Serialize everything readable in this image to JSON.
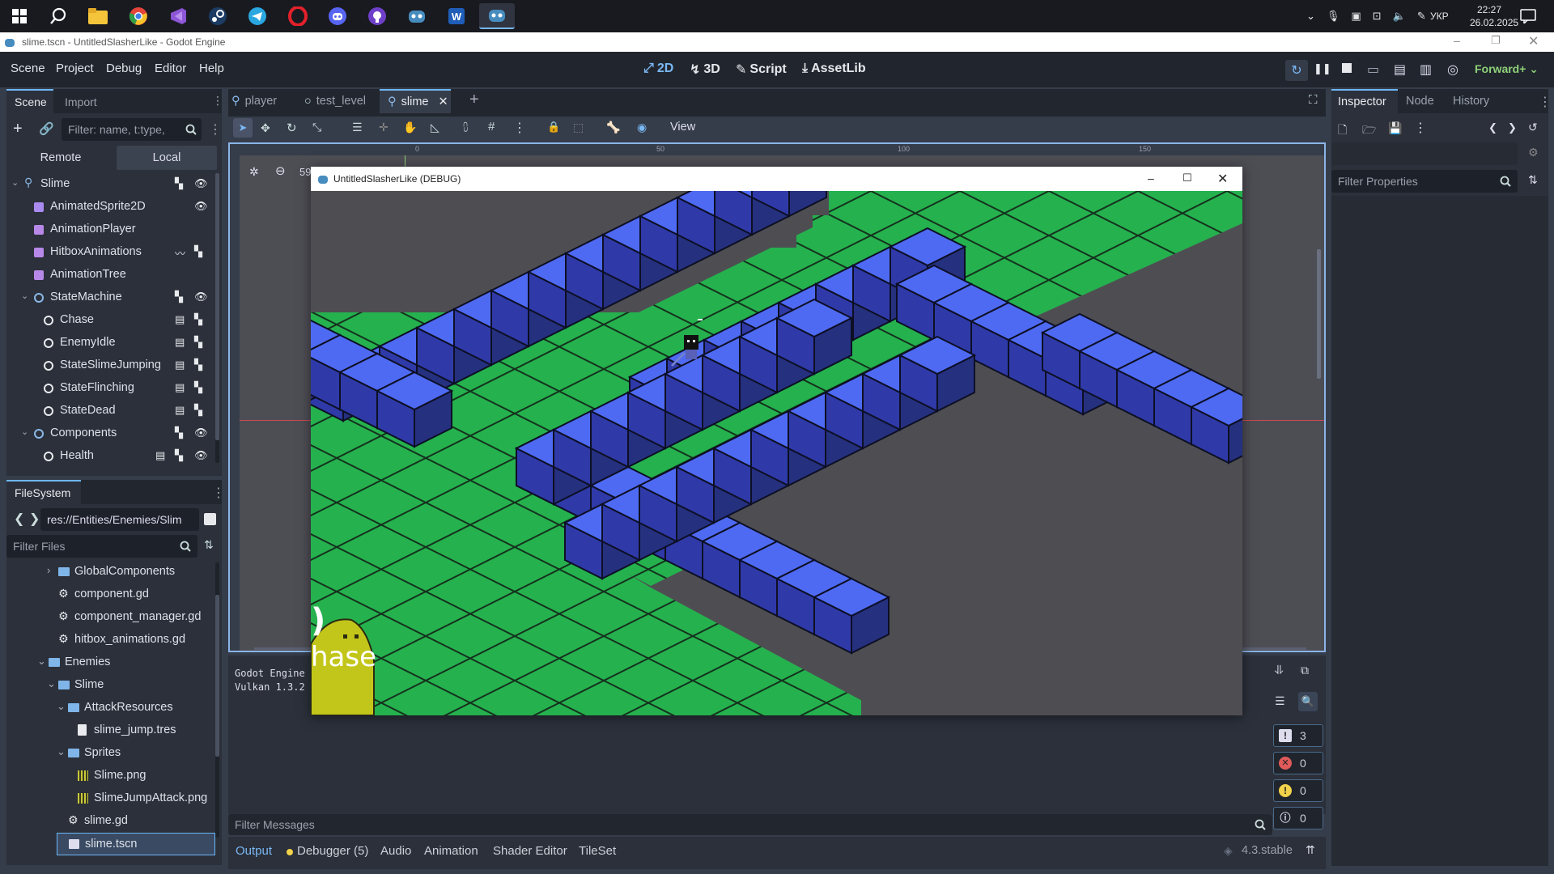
{
  "taskbar": {
    "time": "22:27",
    "date": "26.02.2025",
    "lang": "УКР"
  },
  "window": {
    "title": "slime.tscn - UntitledSlasherLike - Godot Engine"
  },
  "menu": [
    "Scene",
    "Project",
    "Debug",
    "Editor",
    "Help"
  ],
  "main_screens": [
    "2D",
    "3D",
    "Script",
    "AssetLib"
  ],
  "renderer": "Forward+",
  "scene_dock": {
    "tabs": [
      "Scene",
      "Import"
    ],
    "filter_placeholder": "Filter: name, t:type,",
    "remote": "Remote",
    "local": "Local",
    "nodes": [
      {
        "name": "Slime",
        "depth": 0,
        "type": "root"
      },
      {
        "name": "AnimatedSprite2D",
        "depth": 1,
        "type": "sprite"
      },
      {
        "name": "AnimationPlayer",
        "depth": 1,
        "type": "anim"
      },
      {
        "name": "HitboxAnimations",
        "depth": 1,
        "type": "anim"
      },
      {
        "name": "AnimationTree",
        "depth": 1,
        "type": "anim"
      },
      {
        "name": "StateMachine",
        "depth": 1,
        "type": "node"
      },
      {
        "name": "Chase",
        "depth": 2,
        "type": "node"
      },
      {
        "name": "EnemyIdle",
        "depth": 2,
        "type": "node"
      },
      {
        "name": "StateSlimeJumping",
        "depth": 2,
        "type": "node"
      },
      {
        "name": "StateFlinching",
        "depth": 2,
        "type": "node"
      },
      {
        "name": "StateDead",
        "depth": 2,
        "type": "node"
      },
      {
        "name": "Components",
        "depth": 1,
        "type": "node"
      },
      {
        "name": "Health",
        "depth": 2,
        "type": "node"
      }
    ]
  },
  "filesystem": {
    "title": "FileSystem",
    "path": "res://Entities/Enemies/Slim",
    "filter_placeholder": "Filter Files",
    "items": [
      {
        "name": "GlobalComponents",
        "depth": 2,
        "type": "folder"
      },
      {
        "name": "component.gd",
        "depth": 2,
        "type": "script"
      },
      {
        "name": "component_manager.gd",
        "depth": 2,
        "type": "script"
      },
      {
        "name": "hitbox_animations.gd",
        "depth": 2,
        "type": "script"
      },
      {
        "name": "Enemies",
        "depth": 1,
        "type": "folder"
      },
      {
        "name": "Slime",
        "depth": 2,
        "type": "folder"
      },
      {
        "name": "AttackResources",
        "depth": 3,
        "type": "folder"
      },
      {
        "name": "slime_jump.tres",
        "depth": 4,
        "type": "file"
      },
      {
        "name": "Sprites",
        "depth": 3,
        "type": "folder"
      },
      {
        "name": "Slime.png",
        "depth": 4,
        "type": "image"
      },
      {
        "name": "SlimeJumpAttack.png",
        "depth": 4,
        "type": "image"
      },
      {
        "name": "slime.gd",
        "depth": 3,
        "type": "script"
      },
      {
        "name": "slime.tscn",
        "depth": 3,
        "type": "scene"
      }
    ]
  },
  "editor_tabs": [
    "player",
    "test_level",
    "slime"
  ],
  "toolbar": {
    "view": "View",
    "zoom_partial": "59"
  },
  "ruler": [
    "0",
    "50",
    "100",
    "150"
  ],
  "debug_window": {
    "title": "UntitledSlasherLike (DEBUG)",
    "overlay_1": ")",
    "overlay_2": "hase"
  },
  "output": {
    "line1": "Godot Engine",
    "line2": "Vulkan 1.3.2",
    "filter_placeholder": "Filter Messages",
    "counts": [
      "3",
      "0",
      "0",
      "0"
    ]
  },
  "bottom_tabs": [
    "Output",
    "Debugger (5)",
    "Audio",
    "Animation",
    "Shader Editor",
    "TileSet"
  ],
  "version": "4.3.stable",
  "inspector": {
    "tabs": [
      "Inspector",
      "Node",
      "History"
    ],
    "filter_placeholder": "Filter Properties"
  },
  "colors": {
    "accent": "#6eb7f7",
    "block_top": "#4f6af2",
    "block_side": "#2f3aa8",
    "grass": "#25b14e",
    "void": "#4e4e52",
    "slime": "#c3c61a"
  }
}
